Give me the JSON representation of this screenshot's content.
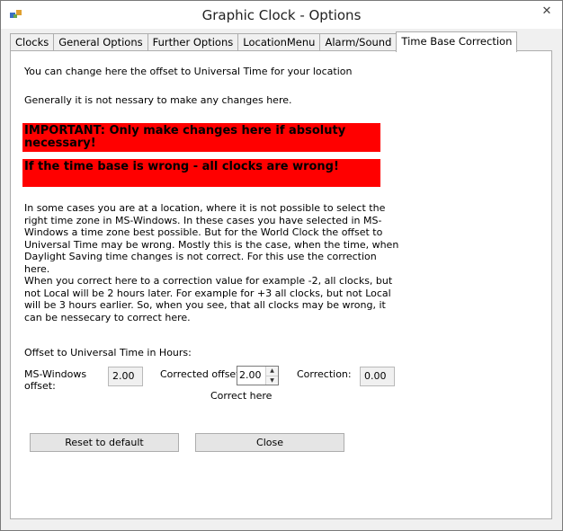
{
  "window": {
    "title": "Graphic Clock - Options",
    "close_glyph": "✕"
  },
  "tabs": [
    {
      "label": "Clocks"
    },
    {
      "label": "General Options"
    },
    {
      "label": "Further Options"
    },
    {
      "label": "LocationMenu"
    },
    {
      "label": "Alarm/Sound"
    },
    {
      "label": "Time Base Correction"
    }
  ],
  "content": {
    "intro": "You can change here the offset to Universal Time for your location",
    "note": "Generally it is not nessary to make any changes here.",
    "warning1": "IMPORTANT: Only make changes here if absoluty necessary!",
    "warning2": "If the time base is wrong - all clocks are wrong!",
    "para1": "In some cases you are at a location, where it is not possible to select the right time zone in MS-Windows. In these cases you have selected in MS-Windows a time zone best possible. But for the World Clock the offset to Universal Time may be wrong. Mostly this is the case, when the time, when Daylight Saving time changes is not correct. For this use the correction here.",
    "para2": "When you correct here to a correction value for example -2, all clocks, but not Local will be 2 hours later. For example for +3 all clocks, but not Local will be 3 hours earlier. So, when you see, that all clocks may be wrong, it can be nessecary to correct here.",
    "offset_heading": "Offset to Universal Time in Hours:"
  },
  "fields": {
    "ms_windows_label": "MS-Windows offset:",
    "ms_windows_value": "2.00",
    "corrected_label": "Corrected offset:",
    "corrected_value": "2.00",
    "correct_here": "Correct here",
    "correction_label": "Correction:",
    "correction_value": "0.00"
  },
  "buttons": {
    "reset": "Reset to default",
    "close": "Close"
  }
}
